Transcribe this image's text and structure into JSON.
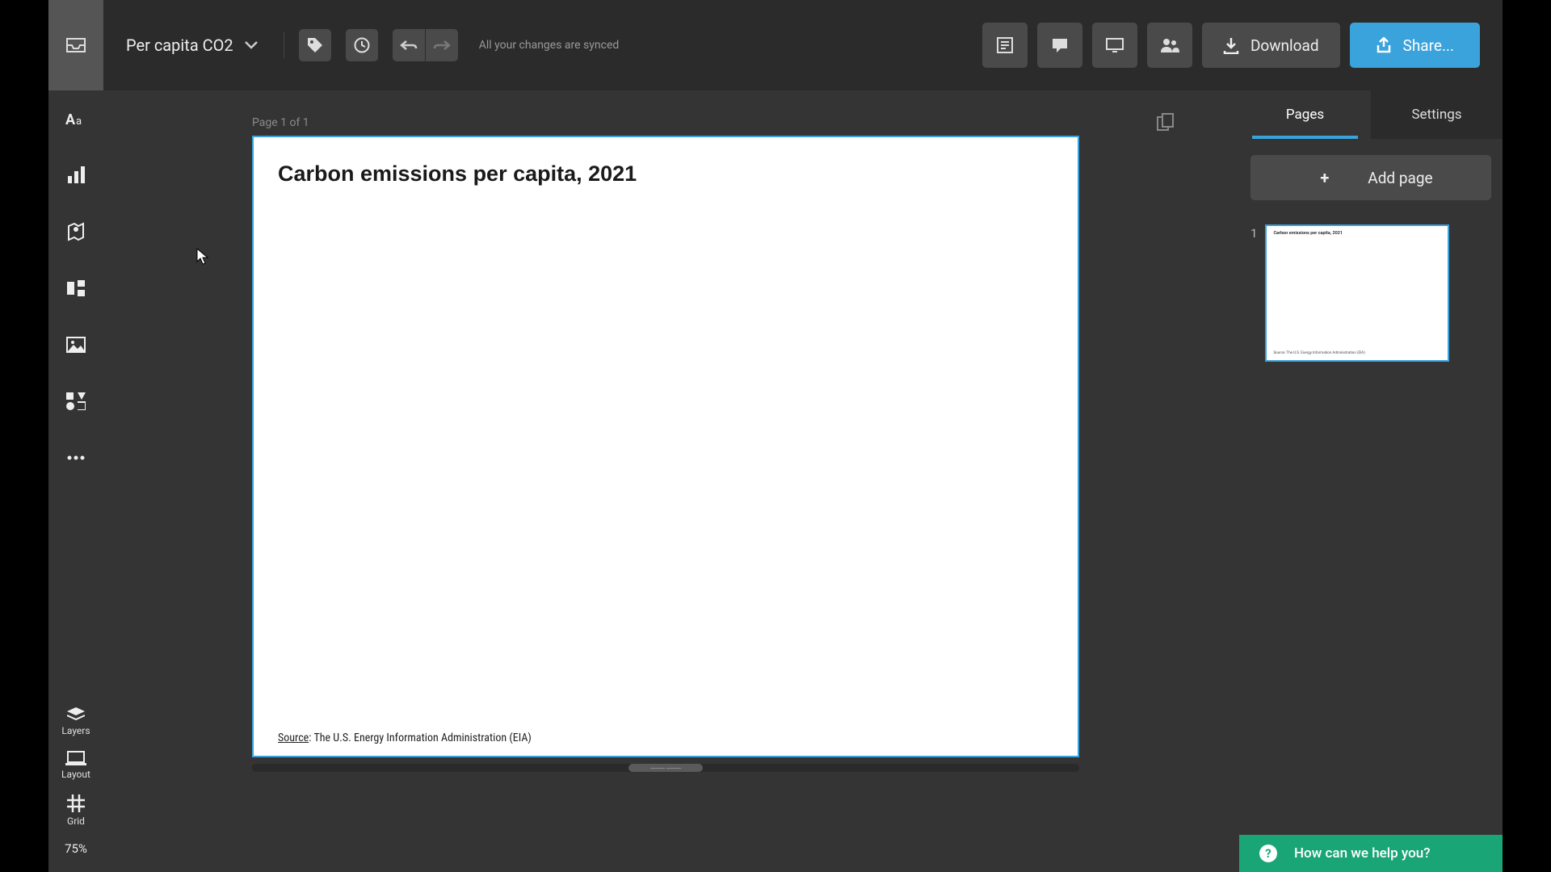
{
  "project": {
    "name": "Per capita CO2"
  },
  "sync_message": "All your changes are synced",
  "toolbar": {
    "download_label": "Download",
    "share_label": "Share..."
  },
  "sidebar": {
    "layers_label": "Layers",
    "layout_label": "Layout",
    "grid_label": "Grid",
    "zoom_label": "75%"
  },
  "canvas": {
    "page_indicator": "Page 1 of 1",
    "title": "Carbon emissions per capita, 2021",
    "source_label": "Source",
    "source_text": ": The U.S. Energy Information Administration (EIA)"
  },
  "right_panel": {
    "tab_pages": "Pages",
    "tab_settings": "Settings",
    "add_page_label": "Add page",
    "pages": [
      {
        "number": "1"
      }
    ]
  },
  "help": {
    "label": "How can we help you?"
  }
}
